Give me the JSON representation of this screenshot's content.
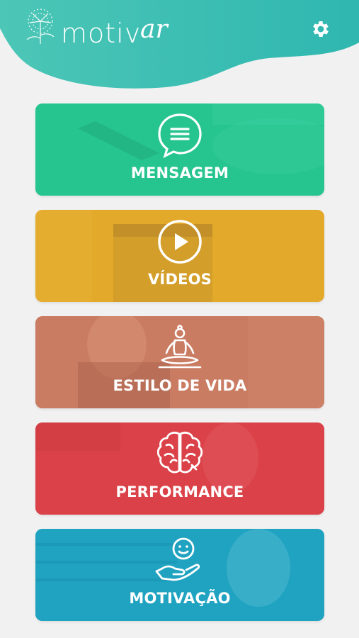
{
  "app": {
    "logo_text": "motiv",
    "logo_script": "ar"
  },
  "colors": {
    "header": "#3ec2b5",
    "mensagem": "#26c48e",
    "videos": "#e2a92a",
    "estilo": "#c97c62",
    "performance": "#db4148",
    "motivacao": "#1fa3c1"
  },
  "cards": [
    {
      "label": "MENSAGEM",
      "icon": "chat-bubble-icon"
    },
    {
      "label": "VÍDEOS",
      "icon": "play-circle-icon"
    },
    {
      "label": "ESTILO DE VIDA",
      "icon": "meditation-icon"
    },
    {
      "label": "PERFORMANCE",
      "icon": "brain-icon"
    },
    {
      "label": "MOTIVAÇÃO",
      "icon": "smile-hand-icon"
    }
  ]
}
